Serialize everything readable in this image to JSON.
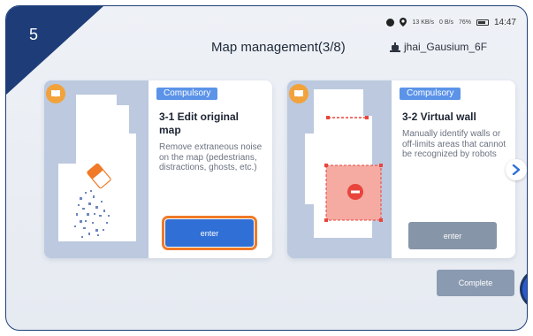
{
  "step": {
    "number": "5"
  },
  "status_bar": {
    "signal_text": "13 KB/s",
    "wifi_text": "0 B/s",
    "battery_text": "76%",
    "time": "14:47"
  },
  "header": {
    "title": "Map management(3/8)",
    "robot_name": "jhai_Gausium_6F"
  },
  "cards": [
    {
      "tag": "Compulsory",
      "heading": "3-1  Edit original map",
      "description": "Remove extraneous noise on the map (pedestrians, distractions, ghosts, etc.)",
      "button": "enter"
    },
    {
      "tag": "Compulsory",
      "heading": "3-2  Virtual wall",
      "description": "Manually identify walls or off-limits areas that cannot be recognized by robots",
      "button": "enter"
    }
  ],
  "footer": {
    "complete": "Complete"
  },
  "colors": {
    "badge": "#1e3d78",
    "tag": "#5b93e8",
    "enter_active": "#2f6fd6",
    "highlight": "#f07a27",
    "disabled": "#8795a8",
    "book_icon": "#f2a23a",
    "virtual_wall": "#e8453c"
  }
}
